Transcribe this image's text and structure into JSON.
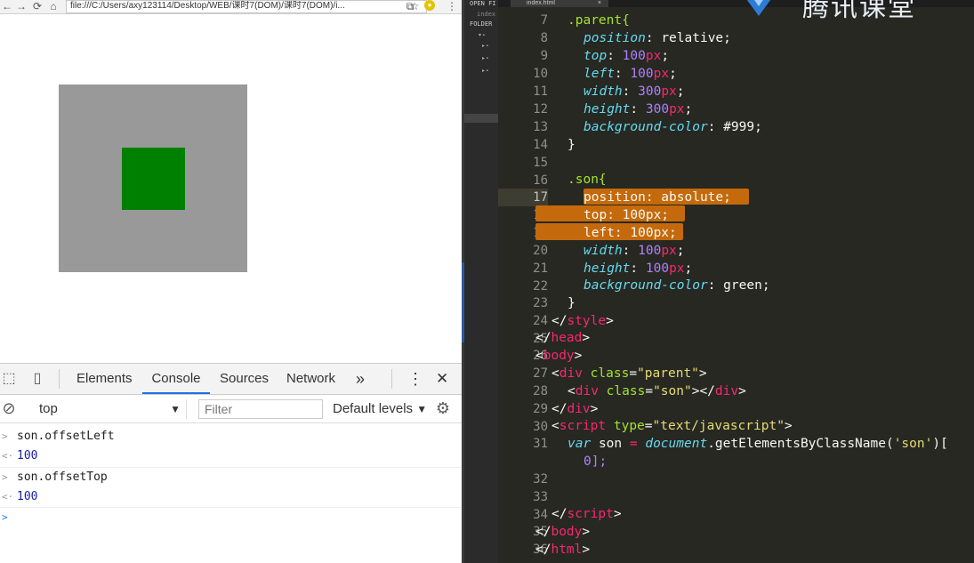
{
  "browser": {
    "address": "file:///C:/Users/axy123114/Desktop/WEB/课时7(DOM)/课时7(DOM)/i...",
    "nav": {
      "back": "←",
      "forward": "→",
      "reload": "⟳",
      "home": "⌂",
      "star": "☆",
      "ext": "●"
    },
    "colors": {
      "parent": "#999999",
      "son": "#008000"
    }
  },
  "devtools": {
    "tabs": [
      "Elements",
      "Console",
      "Sources",
      "Network"
    ],
    "active_tab": "Console",
    "more": "»",
    "menu": "⋮",
    "close": "✕",
    "context": "top",
    "filter_placeholder": "Filter",
    "levels": "Default levels",
    "console": [
      {
        "kind": "input",
        "marker": ">",
        "text": "son.offsetLeft"
      },
      {
        "kind": "output",
        "marker": "<·",
        "text": "100"
      },
      {
        "kind": "input",
        "marker": ">",
        "text": "son.offsetTop"
      },
      {
        "kind": "output",
        "marker": "<·",
        "text": "100"
      },
      {
        "kind": "prompt",
        "marker": ">",
        "text": ""
      }
    ]
  },
  "editor": {
    "sidebar": {
      "open_files": "OPEN FI",
      "folders": "FOLDER",
      "file": "index"
    },
    "tab": {
      "label": "index.html",
      "close": "×"
    },
    "watermark": "腾讯课堂",
    "current_line": 17,
    "line_numbers": [
      7,
      8,
      9,
      10,
      11,
      12,
      13,
      14,
      15,
      16,
      17,
      18,
      19,
      20,
      21,
      22,
      23,
      24,
      25,
      26,
      27,
      28,
      29,
      30,
      31,
      "",
      32,
      33,
      34,
      35,
      36
    ],
    "code": {
      "l7_sel": ".parent{",
      "l8_prop": "position",
      "l8_val": "relative",
      "l9_prop": "top",
      "l9_num": "100",
      "l9_unit": "px",
      "l10_prop": "left",
      "l10_num": "100",
      "l10_unit": "px",
      "l11_prop": "width",
      "l11_num": "300",
      "l11_unit": "px",
      "l12_prop": "height",
      "l12_num": "300",
      "l12_unit": "px",
      "l13_prop": "background-color",
      "l13_val": "#999",
      "l14": "}",
      "l16_sel": ".son{",
      "l17": "position: absolute;",
      "l18": "top: 100px;",
      "l19": "left: 100px;",
      "l20_prop": "width",
      "l20_num": "100",
      "l20_unit": "px",
      "l21_prop": "height",
      "l21_num": "100",
      "l21_unit": "px",
      "l22_prop": "background-color",
      "l22_val": "green",
      "l23": "}",
      "l24_tag": "style",
      "l25_tag": "head",
      "l26_tag": "body",
      "l27_tag": "div",
      "l27_attr": "class",
      "l27_str": "\"parent\"",
      "l28_tag": "div",
      "l28_attr": "class",
      "l28_str": "\"son\"",
      "l28_close": "div",
      "l29_tag": "div",
      "l30_tag": "script",
      "l30_attr": "type",
      "l30_str": "\"text/javascript\"",
      "l31_kw": "var",
      "l31_var": "son",
      "l31_obj": "document",
      "l31_fn": ".getElementsByClassName(",
      "l31_str": "'son'",
      "l31_end": ")[",
      "l31b": "0];",
      "l34_tag": "script",
      "l35_tag": "body",
      "l36_tag": "html"
    }
  }
}
